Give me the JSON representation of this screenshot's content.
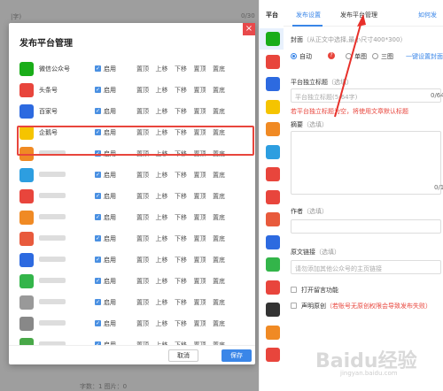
{
  "background": {
    "hint": "|字)",
    "count": "0/30",
    "bottom_text": "字数：1  图片：0"
  },
  "modal": {
    "title": "发布平台管理",
    "close_glyph": "×",
    "enable_label": "启用",
    "actions": [
      "置顶",
      "上移",
      "下移",
      "置顶",
      "置底"
    ],
    "cancel_label": "取消",
    "save_label": "保存",
    "rows": [
      {
        "name": "微信公众号",
        "color": "#1aad19",
        "blurred": false
      },
      {
        "name": "头条号",
        "color": "#e8453c",
        "blurred": false
      },
      {
        "name": "百家号",
        "color": "#2d6ae0",
        "blurred": false,
        "highlighted": true
      },
      {
        "name": "企鹅号",
        "color": "#f5c400",
        "blurred": false
      },
      {
        "name": "",
        "color": "#f08a24",
        "blurred": true
      },
      {
        "name": "",
        "color": "#2d9ee0",
        "blurred": true
      },
      {
        "name": "",
        "color": "#e8453c",
        "blurred": true
      },
      {
        "name": "",
        "color": "#f08a24",
        "blurred": true
      },
      {
        "name": "",
        "color": "#e85a3c",
        "blurred": true
      },
      {
        "name": "",
        "color": "#2d6ae0",
        "blurred": true
      },
      {
        "name": "",
        "color": "#33b54a",
        "blurred": true
      },
      {
        "name": "",
        "color": "#999999",
        "blurred": true
      },
      {
        "name": "",
        "color": "#888888",
        "blurred": true
      },
      {
        "name": "",
        "color": "#48a848",
        "blurred": true
      }
    ]
  },
  "platform_column": {
    "heading": "平台",
    "icons": [
      {
        "name": "wechat-icon",
        "color": "#1aad19"
      },
      {
        "name": "toutiao-icon",
        "color": "#e8453c"
      },
      {
        "name": "baijiahao-icon",
        "color": "#2d6ae0"
      },
      {
        "name": "penguin-icon",
        "color": "#f5c400"
      },
      {
        "name": "uc-icon",
        "color": "#f08a24"
      },
      {
        "name": "yidian-icon",
        "color": "#2d9ee0"
      },
      {
        "name": "sohu-icon",
        "color": "#e8453c"
      },
      {
        "name": "netease-icon",
        "color": "#e8453c"
      },
      {
        "name": "weibo-icon",
        "color": "#e85a3c"
      },
      {
        "name": "zhihu-icon",
        "color": "#2d6ae0"
      },
      {
        "name": "iqiyi-icon",
        "color": "#33b54a"
      },
      {
        "name": "toutiao2-icon",
        "color": "#e8453c"
      },
      {
        "name": "bilibili-icon",
        "color": "#333333"
      },
      {
        "name": "dayu-icon",
        "color": "#f08a24"
      },
      {
        "name": "phoenix-icon",
        "color": "#e8453c"
      }
    ]
  },
  "panel": {
    "tab_publish_settings": "发布设置",
    "tab_platform_manage": "发布平台管理",
    "tab_help": "如何发",
    "cover_label": "封面",
    "cover_hint": "（从正文中选择,最小尺寸400*300）",
    "opt_auto": "自动",
    "opt_single": "单图",
    "opt_three": "三图",
    "one_key_cover": "一键设置封面",
    "title_label": "平台独立标题",
    "title_optional": "（选填）",
    "title_placeholder": "平台独立标题(5-64字)",
    "title_count": "0/64",
    "title_warning": "若平台独立标题为空，将使用文章默认标题",
    "summary_label": "摘要",
    "summary_optional": "（选填）",
    "summary_count": "0/1",
    "author_label": "作者",
    "author_optional": "（选填）",
    "source_label": "原文链接",
    "source_optional": "（选填）",
    "source_placeholder": "请勿添加其他公众号的主页链接",
    "comment_label": "打开留言功能",
    "original_label": "声明原创",
    "original_note": "（若账号无原创权限会导致发布失败）"
  },
  "watermark": {
    "text": "Baidu经验",
    "sub": "jingyan.baidu.com"
  }
}
